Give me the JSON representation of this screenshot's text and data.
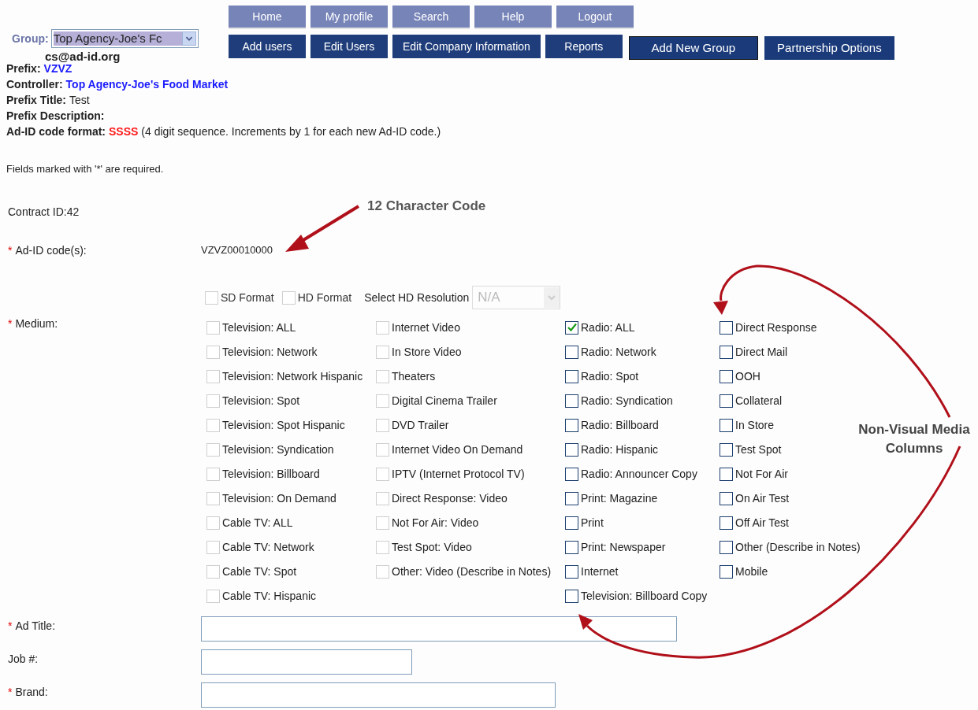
{
  "group": {
    "label": "Group:",
    "value": "Top Agency-Joe's Fc"
  },
  "email": "cs@ad-id.org",
  "nav_top": [
    "Home",
    "My profile",
    "Search",
    "Help",
    "Logout"
  ],
  "nav_bottom": [
    "Add users",
    "Edit Users",
    "Edit Company Information",
    "Reports"
  ],
  "nav_extra": [
    "Add New Group",
    "Partnership Options"
  ],
  "info": [
    {
      "label": "Prefix:",
      "value": "VZVZ",
      "kind": "link"
    },
    {
      "label": "Controller:",
      "value": "Top Agency-Joe's Food Market",
      "kind": "link"
    },
    {
      "label": "Prefix Title:",
      "value": "Test",
      "kind": "plain"
    },
    {
      "label": "Prefix Description:"
    },
    {
      "label": "Ad-ID code format:",
      "value": "SSSS",
      "kind": "alert",
      "note": "(4 digit sequence. Increments by 1 for each new Ad-ID code.)"
    }
  ],
  "required_note": "Fields marked with '*' are required.",
  "required_mark": "*",
  "contract_id": "Contract ID:42",
  "ad_id": {
    "label": "Ad-ID code(s):",
    "required": true,
    "value": "VZVZ00010000"
  },
  "formats": [
    {
      "label": "SD Format",
      "checked": false,
      "disabled": true
    },
    {
      "label": "HD Format",
      "checked": false,
      "disabled": true
    }
  ],
  "hd_resolution": {
    "label": "Select HD Resolution",
    "value": "N/A",
    "disabled": true
  },
  "medium": {
    "label": "Medium:",
    "required": true,
    "columns": [
      [
        {
          "label": "Television: ALL",
          "checked": false,
          "disabled": true
        },
        {
          "label": "Television: Network",
          "checked": false,
          "disabled": true
        },
        {
          "label": "Television: Network Hispanic",
          "checked": false,
          "disabled": true
        },
        {
          "label": "Television: Spot",
          "checked": false,
          "disabled": true
        },
        {
          "label": "Television: Spot Hispanic",
          "checked": false,
          "disabled": true
        },
        {
          "label": "Television: Syndication",
          "checked": false,
          "disabled": true
        },
        {
          "label": "Television: Billboard",
          "checked": false,
          "disabled": true
        },
        {
          "label": "Television: On Demand",
          "checked": false,
          "disabled": true
        },
        {
          "label": "Cable TV: ALL",
          "checked": false,
          "disabled": true
        },
        {
          "label": "Cable TV: Network",
          "checked": false,
          "disabled": true
        },
        {
          "label": "Cable TV: Spot",
          "checked": false,
          "disabled": true
        },
        {
          "label": "Cable TV: Hispanic",
          "checked": false,
          "disabled": true
        }
      ],
      [
        {
          "label": "Internet Video",
          "checked": false,
          "disabled": true
        },
        {
          "label": "In Store Video",
          "checked": false,
          "disabled": true
        },
        {
          "label": "Theaters",
          "checked": false,
          "disabled": true
        },
        {
          "label": "Digital Cinema Trailer",
          "checked": false,
          "disabled": true
        },
        {
          "label": "DVD Trailer",
          "checked": false,
          "disabled": true
        },
        {
          "label": "Internet Video On Demand",
          "checked": false,
          "disabled": true
        },
        {
          "label": "IPTV (Internet Protocol TV)",
          "checked": false,
          "disabled": true
        },
        {
          "label": "Direct Response: Video",
          "checked": false,
          "disabled": true
        },
        {
          "label": "Not For Air: Video",
          "checked": false,
          "disabled": true
        },
        {
          "label": "Test Spot: Video",
          "checked": false,
          "disabled": true
        },
        {
          "label": "Other: Video (Describe in Notes)",
          "checked": false,
          "disabled": true
        }
      ],
      [
        {
          "label": "Radio: ALL",
          "checked": true,
          "disabled": false
        },
        {
          "label": "Radio: Network",
          "checked": false,
          "disabled": false
        },
        {
          "label": "Radio: Spot",
          "checked": false,
          "disabled": false
        },
        {
          "label": "Radio: Syndication",
          "checked": false,
          "disabled": false
        },
        {
          "label": "Radio: Billboard",
          "checked": false,
          "disabled": false
        },
        {
          "label": "Radio: Hispanic",
          "checked": false,
          "disabled": false
        },
        {
          "label": "Radio: Announcer Copy",
          "checked": false,
          "disabled": false
        },
        {
          "label": "Print: Magazine",
          "checked": false,
          "disabled": false
        },
        {
          "label": "Print",
          "checked": false,
          "disabled": false
        },
        {
          "label": "Print: Newspaper",
          "checked": false,
          "disabled": false
        },
        {
          "label": "Internet",
          "checked": false,
          "disabled": false
        },
        {
          "label": "Television: Billboard Copy",
          "checked": false,
          "disabled": false
        }
      ],
      [
        {
          "label": "Direct Response",
          "checked": false,
          "disabled": false
        },
        {
          "label": "Direct Mail",
          "checked": false,
          "disabled": false
        },
        {
          "label": "OOH",
          "checked": false,
          "disabled": false
        },
        {
          "label": "Collateral",
          "checked": false,
          "disabled": false
        },
        {
          "label": "In Store",
          "checked": false,
          "disabled": false
        },
        {
          "label": "Test Spot",
          "checked": false,
          "disabled": false
        },
        {
          "label": "Not For Air",
          "checked": false,
          "disabled": false
        },
        {
          "label": "On Air Test",
          "checked": false,
          "disabled": false
        },
        {
          "label": "Off Air Test",
          "checked": false,
          "disabled": false
        },
        {
          "label": "Other (Describe in Notes)",
          "checked": false,
          "disabled": false
        },
        {
          "label": "Mobile",
          "checked": false,
          "disabled": false
        }
      ]
    ]
  },
  "text_fields": [
    {
      "label": "Ad Title:",
      "required": true
    },
    {
      "label": "Job #:",
      "required": false
    },
    {
      "label": "Brand:",
      "required": true
    }
  ],
  "annotations": [
    "12 Character Code",
    "Non-Visual Media Columns"
  ]
}
